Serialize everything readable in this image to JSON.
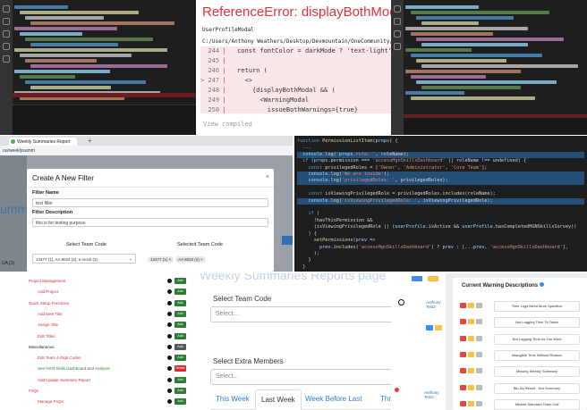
{
  "reference_error": {
    "title": "ReferenceError: displayBothModal",
    "component": "UserProfileModal",
    "file_path": "C:/Users/Anthony Weathers/Desktop/Devmountain/OneCommunity/HighestGoodNetwork",
    "lines": [
      {
        "num": "244",
        "code": "  const fontColor = darkMode ? 'text-light' : '';"
      },
      {
        "num": "245",
        "code": ""
      },
      {
        "num": "246",
        "code": "  return ("
      },
      {
        "num": "247",
        "code": "    <>"
      },
      {
        "num": "248",
        "code": "      {displayBothModal && ("
      },
      {
        "num": "249",
        "code": "        <WarningModal"
      },
      {
        "num": "250",
        "code": "          issueBothWarnings={true}"
      }
    ],
    "highlight_line": "247",
    "footer": "View compiled"
  },
  "filter_modal": {
    "browser_tab": "Weekly Summaries Report",
    "address": "ou/weeklysumm",
    "title": "Create A New Filter",
    "close": "×",
    "name_label": "Filter Name",
    "name_value": "test filter",
    "desc_label": "Filter Description",
    "desc_value": "this is for testing purpose",
    "select_team_label": "Select Team Code",
    "selected_team_label": "Selected Team Code",
    "select_team_value": "13477 (1), AA 8024 (2), a mock (2)",
    "selected_chips": [
      "13477 (1) ×",
      "AA 8024 (2) ×"
    ],
    "behind_text": "umm",
    "behind_left": "UA (3)"
  },
  "code": {
    "lines": [
      "function PermissionListItem(props) {",
      "  ...",
      "  console.log('props.role: ', roleName);",
      "  if (props.permission === 'accessHgnSkillsDashboard' || roleName !== undefined) {",
      "    const privilegedRoles = ['Owner', 'Administrator', 'Core Team'];",
      "    console.log('We are inside');",
      "    console.log('privilegedRoles: ', privilegedRoles);",
      "",
      "    const isViewingPrivilegedRole = privilegedRoles.includes(roleName);",
      "    console.log('isViewingPrivilegedRole: ', isViewingPrivilegedRole);",
      "",
      "    if (",
      "      !hasThisPermission &&",
      "      (isViewingPrivilegedRole || (userProfile.isActive && userProfile.hasCompletedHGNSkillsSurvey))",
      "    ) {",
      "      setPermissions(prev =>",
      "        prev.includes('accessHgnSkillsDashboard') ? prev : [...prev, 'accessHgnSkillsDashboard'],",
      "      );",
      "    }",
      "  }"
    ]
  },
  "permissions": [
    {
      "name": "Project Management",
      "color": "#d32f2f",
      "indent": 0,
      "btn": "Add",
      "btn_color": "#2e7d32"
    },
    {
      "name": "Add Project",
      "color": "#d32f2f",
      "indent": 1,
      "btn": "Add",
      "btn_color": "#2e7d32"
    },
    {
      "name": "Quick Setup Functions",
      "color": "#d32f2f",
      "indent": 0,
      "btn": "Add",
      "btn_color": "#2e7d32"
    },
    {
      "name": "Add New Title",
      "color": "#d32f2f",
      "indent": 1,
      "btn": "Add",
      "btn_color": "#2e7d32"
    },
    {
      "name": "Assign Title",
      "color": "#d32f2f",
      "indent": 1,
      "btn": "Add",
      "btn_color": "#2e7d32"
    },
    {
      "name": "Edit Titles",
      "color": "#d32f2f",
      "indent": 1,
      "btn": "Add",
      "btn_color": "#2e7d32"
    },
    {
      "name": "Miscellaneous",
      "color": "#222222",
      "indent": 0,
      "btn": "Add",
      "btn_color": "#555555"
    },
    {
      "name": "Edit Team 4-Digit Codes",
      "color": "#d32f2f",
      "indent": 1,
      "btn": "Add",
      "btn_color": "#2e7d32"
    },
    {
      "name": "See HGN Skills Dashboard and Analysis",
      "color": "#2e7d32",
      "indent": 1,
      "btn": "Delete",
      "btn_color": "#d32f2f"
    },
    {
      "name": "Add Update Summary Report",
      "color": "#d32f2f",
      "indent": 1,
      "btn": "Add",
      "btn_color": "#2e7d32"
    },
    {
      "name": "FAQs",
      "color": "#d32f2f",
      "indent": 0,
      "btn": "Add",
      "btn_color": "#2e7d32"
    },
    {
      "name": "Manage FAQs",
      "color": "#d32f2f",
      "indent": 1,
      "btn": "Add",
      "btn_color": "#2e7d32"
    }
  ],
  "weekly": {
    "title": "Weekly Summaries Reports page",
    "team_label": "Select Team Code",
    "team_placeholder": "Select...",
    "members_label": "Select Extra Members",
    "members_placeholder": "Select...",
    "tabs": [
      "This Week",
      "Last Week",
      "Week Before Last",
      "Three"
    ],
    "active_tab": 1
  },
  "warnings": {
    "title": "Current Warning Descriptions",
    "name_1": "Anthony Test2",
    "name_2": "Anthony Test2",
    "items": [
      "Time Logs Need More Specifics",
      "Not Logging Time To Tasks",
      "Not Logging Time As You Work",
      "Intangible Time Without Reason",
      "Missing Weekly Summary",
      "Blu Sq Result - Not Summary",
      "Missed Standard Team Call"
    ],
    "accent": "#e8453c"
  }
}
